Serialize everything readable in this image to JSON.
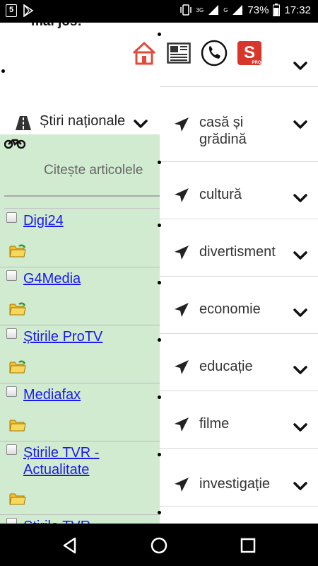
{
  "status_bar": {
    "battery": "73%",
    "time": "17:32",
    "network_labels": [
      "3G",
      "G"
    ],
    "left_icons": [
      "html5-icon",
      "play-store-icon"
    ]
  },
  "header": {
    "top_text": "mai jos:",
    "icons": [
      "home-icon",
      "newspaper-icon",
      "phone-icon",
      "s-pro-icon"
    ]
  },
  "section": {
    "title": "Știri naționale"
  },
  "feed": {
    "intro": "Citește articolele",
    "sources": [
      {
        "name": "Digi24"
      },
      {
        "name": "G4Media"
      },
      {
        "name": "Știrile ProTV"
      },
      {
        "name": "Mediafax"
      },
      {
        "name": "Știrile TVR - Actualitate"
      },
      {
        "name": "Știrile TVR"
      }
    ]
  },
  "menu": {
    "items": [
      {
        "label": ""
      },
      {
        "label": "casă și grădină"
      },
      {
        "label": "cultură"
      },
      {
        "label": "divertisment"
      },
      {
        "label": "economie"
      },
      {
        "label": "educație"
      },
      {
        "label": "filme"
      },
      {
        "label": "investigație"
      }
    ]
  },
  "colors": {
    "green_panel": "#d1ebd1",
    "link": "#1a1aee",
    "home_icon": "#e04b3a",
    "s_icon": "#d9362b"
  }
}
